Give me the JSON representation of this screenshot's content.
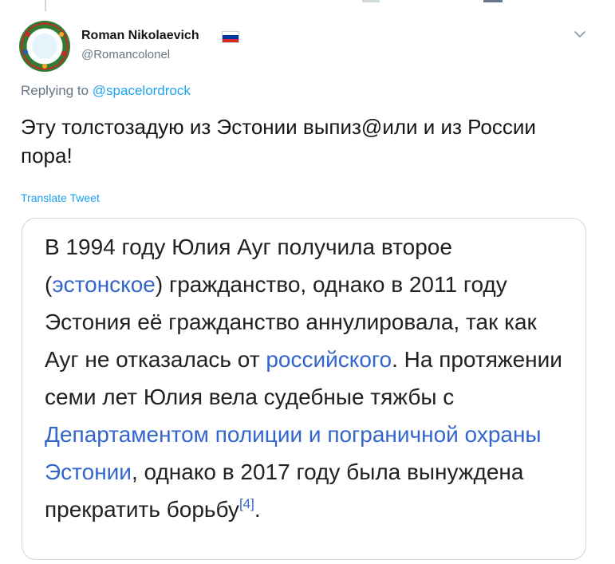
{
  "author": {
    "display_name": "Roman Nikolaevich",
    "handle": "@Romancolonel",
    "flag_icon": "russia-flag-icon",
    "flag_colors": [
      "#ffffff",
      "#0039a6",
      "#d52b1e"
    ]
  },
  "reply": {
    "prefix": "Replying to",
    "mention": "@spacelordrock"
  },
  "tweet": {
    "text": "Эту толстозадую из Эстонии выпиз@или и из России пора!",
    "translate_label": "Translate Tweet"
  },
  "card": {
    "segments": [
      "В 1994 году Юлия Ауг получила второе (",
      "эстонское",
      ") гражданство, однако в 2011 году Эстония её гражданство аннулировала, так как Ауг не отказалась от ",
      "российского",
      ". На протяжении семи лет Юлия вела судебные тяжбы с ",
      "Департаментом полиции и пограничной охраны Эстонии",
      ", однако в 2017 году была вынуждена прекратить борьбу",
      "[4]",
      "."
    ]
  },
  "colors": {
    "twitter_blue": "#1da1f2",
    "wiki_link": "#3366cc",
    "muted_text": "#657786",
    "border": "#ccd6dd"
  },
  "icons": {
    "caret": "chevron-down-icon"
  }
}
